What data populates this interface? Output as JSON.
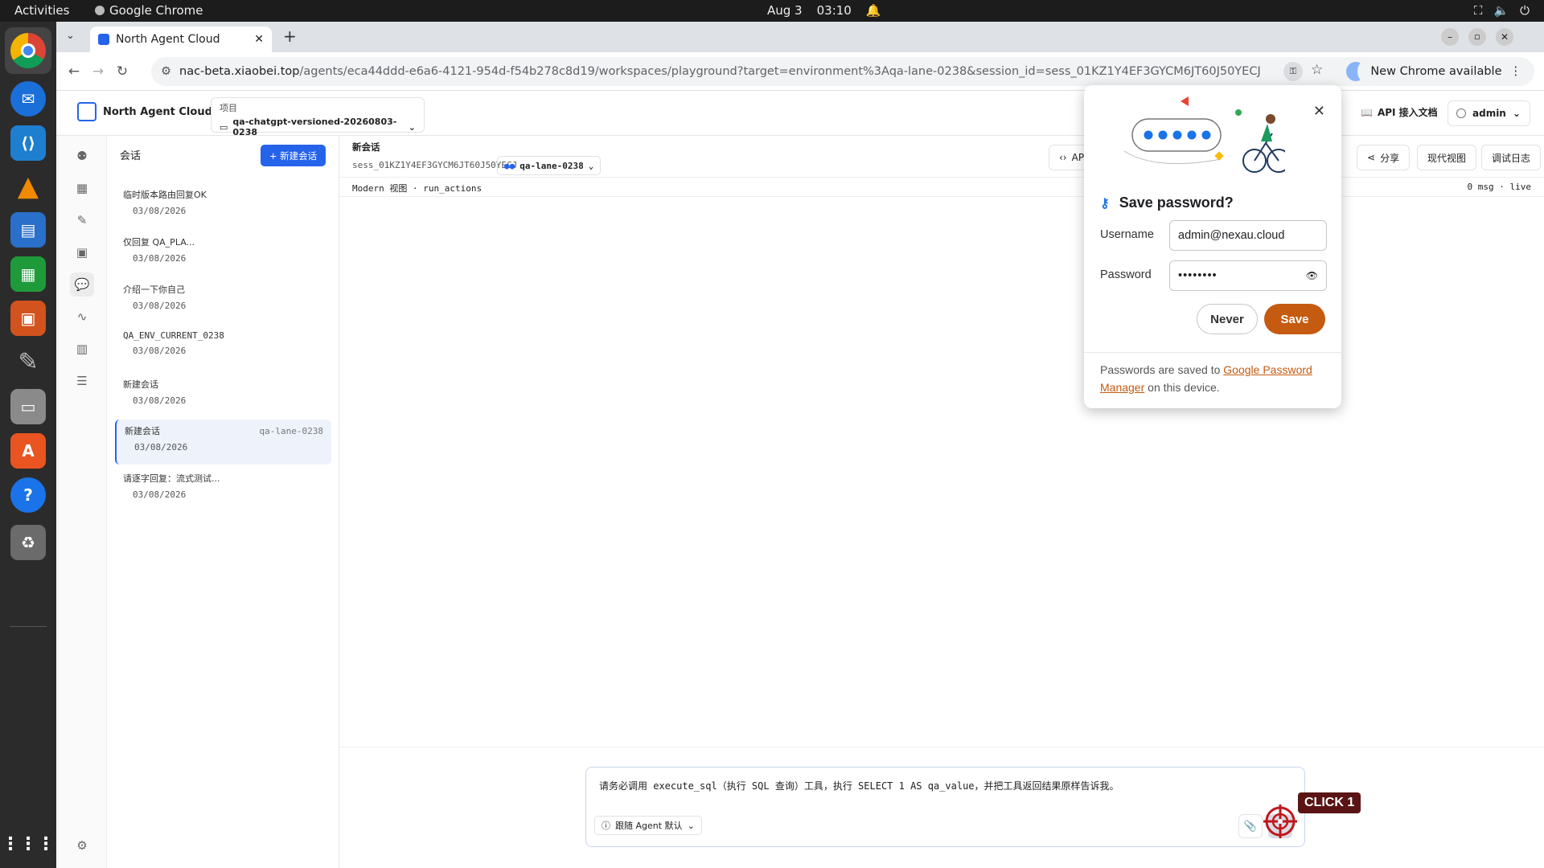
{
  "system_bar": {
    "activities": "Activities",
    "app_name": "Google Chrome",
    "date": "Aug 3",
    "time": "03:10"
  },
  "dock": {
    "items": [
      "chrome-icon",
      "thunderbird-icon",
      "vscode-icon",
      "vlc-icon",
      "writer-icon",
      "calc-icon",
      "impress-icon",
      "gimp-icon",
      "files-icon",
      "app-center-icon",
      "help-icon",
      "trash-icon",
      "app-grid-icon"
    ]
  },
  "browser": {
    "tab_title": "North Agent Cloud",
    "url_host": "nac-beta.xiaobei.top",
    "url_path": "/agents/eca44ddd-e6a6-4121-954d-f54b278c8d19/workspaces/playground?target=environment%3Aqa-lane-0238&session_id=sess_01KZ1Y4EF3GYCM6JT60J50YECJ",
    "new_chrome": "New Chrome available"
  },
  "app": {
    "brand": "North Agent Cloud",
    "project_label": "项目",
    "project_value": "qa-chatgpt-versioned-20260803-0238",
    "api_doc": "API 接入文档",
    "user": "admin"
  },
  "sessions": {
    "title": "会话",
    "new_button": "+ 新建会话",
    "items": [
      {
        "title": "临时版本路由回复OK",
        "date": "03/08/2026",
        "tag": ""
      },
      {
        "title": "仅回复 QA_PLA...",
        "date": "03/08/2026",
        "tag": ""
      },
      {
        "title": "介绍一下你自己",
        "date": "03/08/2026",
        "tag": ""
      },
      {
        "title": "QA_ENV_CURRENT_0238",
        "date": "03/08/2026",
        "tag": ""
      },
      {
        "title": "新建会话",
        "date": "03/08/2026",
        "tag": ""
      },
      {
        "title": "新建会话",
        "date": "03/08/2026",
        "tag": "qa-lane-0238"
      },
      {
        "title": "请逐字回复：流式测试...",
        "date": "03/08/2026",
        "tag": ""
      }
    ]
  },
  "main": {
    "title": "新会话",
    "session_id": "sess_01KZ1Y4EF3GYCM6JT60J50YECJ",
    "lane": "qa-lane-0238",
    "api_btn": "API",
    "share": "分享",
    "modern_view": "现代视图",
    "debug_log": "调试日志",
    "view_info": "Modern 视图 · run_actions",
    "status": "0 msg · live"
  },
  "composer": {
    "text": "请务必调用 execute_sql（执行 SQL 查询）工具，执行 SELECT 1 AS qa_value，并把工具返回结果原样告诉我。",
    "agent_label": "跟随 Agent 默认"
  },
  "overlay": {
    "click_label": "CLICK 1"
  },
  "password_popup": {
    "title": "Save password?",
    "username_label": "Username",
    "username_value": "admin@nexau.cloud",
    "password_label": "Password",
    "password_value": "••••••••",
    "never": "Never",
    "save": "Save",
    "footer_pre": "Passwords are saved to ",
    "footer_link": "Google Password Manager",
    "footer_post": " on this device."
  }
}
